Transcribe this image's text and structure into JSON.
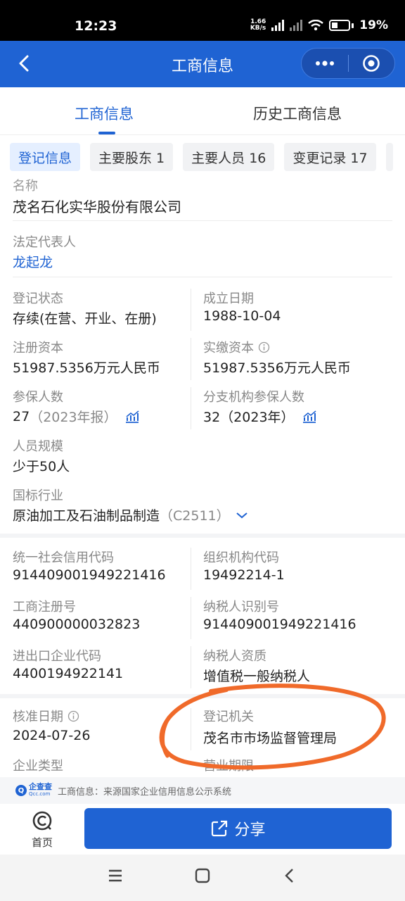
{
  "status_bar": {
    "time": "12:23",
    "net_speed_value": "1.66",
    "net_speed_unit": "KB/s",
    "battery": "19%"
  },
  "header": {
    "title": "工商信息"
  },
  "main_tabs": [
    {
      "label": "工商信息",
      "active": true
    },
    {
      "label": "历史工商信息",
      "active": false
    }
  ],
  "chips": [
    {
      "label": "登记信息",
      "active": true
    },
    {
      "label": "主要股东 1"
    },
    {
      "label": "主要人员 16"
    },
    {
      "label": "变更记录 17"
    }
  ],
  "info": {
    "name_label": "名称",
    "company_name": "茂名石化实华股份有限公司",
    "legal_rep_label": "法定代表人",
    "legal_rep": "龙起龙",
    "reg_status_label": "登记状态",
    "reg_status": "存续(在营、开业、在册)",
    "found_date_label": "成立日期",
    "found_date": "1988-10-04",
    "reg_capital_label": "注册资本",
    "reg_capital": "51987.5356万元人民币",
    "paid_capital_label": "实缴资本",
    "paid_capital": "51987.5356万元人民币",
    "insured_label": "参保人数",
    "insured_value": "27",
    "insured_note": "（2023年报）",
    "branch_insured_label": "分支机构参保人数",
    "branch_insured_value": "32（2023年）",
    "staff_size_label": "人员规模",
    "staff_size": "少于50人",
    "industry_label": "国标行业",
    "industry": "原油加工及石油制品制造",
    "industry_code": "（C2511）",
    "credit_code_label": "统一社会信用代码",
    "credit_code": "914409001949221416",
    "org_code_label": "组织机构代码",
    "org_code": "19492214-1",
    "reg_no_label": "工商注册号",
    "reg_no": "440900000032823",
    "taxpayer_id_label": "纳税人识别号",
    "taxpayer_id": "914409001949221416",
    "import_export_label": "进出口企业代码",
    "import_export": "4400194922141",
    "taxpayer_qual_label": "纳税人资质",
    "taxpayer_qual": "增值税一般纳税人",
    "approve_date_label": "核准日期",
    "approve_date": "2024-07-26",
    "reg_authority_label": "登记机关",
    "reg_authority": "茂名市市场监督管理局",
    "company_type_label": "企业类型",
    "business_term_label": "营业期限"
  },
  "source": {
    "logo_text": "企查查",
    "logo_sub": "Qcc.com",
    "text": "工商信息：来源国家企业信用信息公示系统"
  },
  "bottom": {
    "home_label": "首页",
    "share_label": "分享"
  },
  "colors": {
    "primary": "#1f63d3",
    "annotation": "#f06a2a"
  }
}
